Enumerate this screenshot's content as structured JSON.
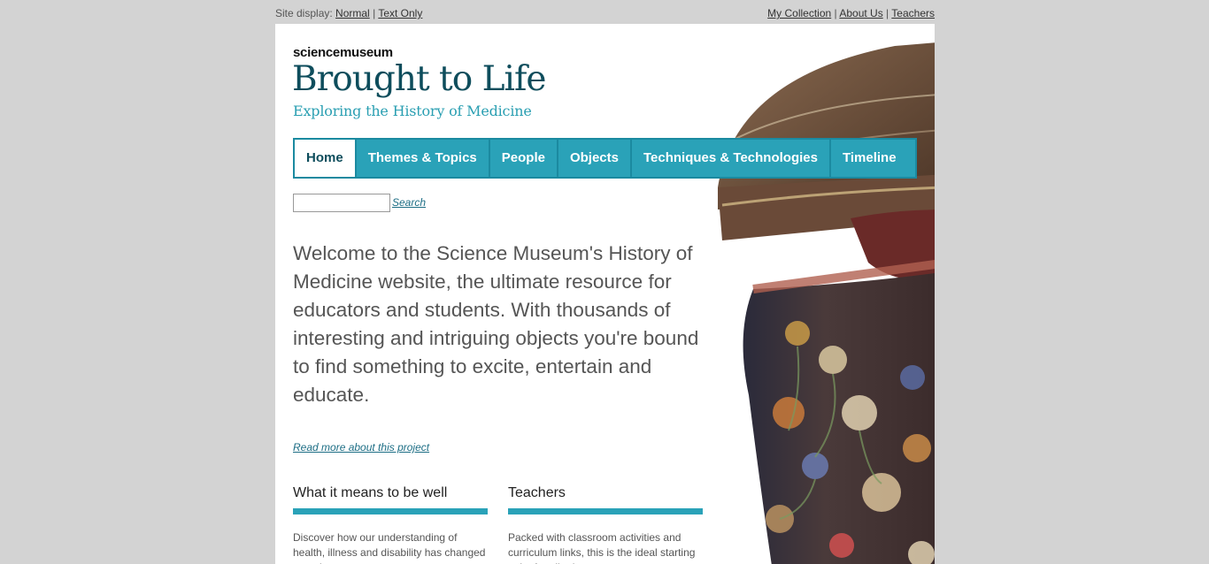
{
  "topbar": {
    "site_display_label": "Site display:",
    "normal_link": "Normal",
    "sep1": "|",
    "text_only_link": "Text Only",
    "my_collection": "My Collection",
    "sep2": "|",
    "about_us": "About Us",
    "sep3": "|",
    "teachers": "Teachers"
  },
  "brand": {
    "science_museum": "sciencemuseum",
    "title": "Brought to Life",
    "subtitle": "Exploring the History of Medicine"
  },
  "nav": {
    "items": [
      {
        "label": "Home"
      },
      {
        "label": "Themes & Topics"
      },
      {
        "label": "People"
      },
      {
        "label": "Objects"
      },
      {
        "label": "Techniques & Technologies"
      },
      {
        "label": "Timeline"
      }
    ]
  },
  "search": {
    "value": "",
    "link": "Search"
  },
  "main": {
    "welcome": "Welcome to the Science Museum's History of Medicine website, the ultimate resource for educators and students. With thousands of interesting and intriguing objects you're bound to find something to excite, entertain and educate.",
    "read_more": "Read more about this project"
  },
  "cards": [
    {
      "title": "What it means to be well",
      "desc": "Discover how our understanding of health, illness and disability has changed over time."
    },
    {
      "title": "Teachers",
      "desc": "Packed with classroom activities and curriculum links, this is the ideal starting point for all educators."
    }
  ],
  "colors": {
    "accent": "#2aa2b8",
    "brand_dark": "#0e4d5c",
    "link": "#1d6e85"
  },
  "icons": {
    "hero_image": "decorated-jar-image"
  }
}
